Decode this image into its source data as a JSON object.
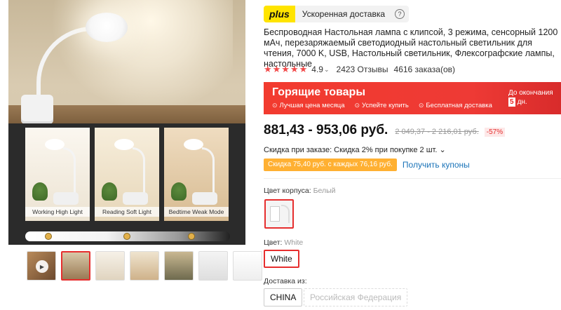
{
  "gallery": {
    "panels": [
      {
        "label": "Working High Light",
        "bg": "#f3ecdf"
      },
      {
        "label": "Reading Soft Light",
        "bg": "#f1e6d2"
      },
      {
        "label": "Bedtime Weak Mode",
        "bg": "#e6d2b4"
      }
    ],
    "thumbnails": [
      {
        "kind": "video"
      },
      {
        "kind": "image"
      },
      {
        "kind": "image"
      },
      {
        "kind": "image"
      },
      {
        "kind": "image"
      },
      {
        "kind": "image"
      },
      {
        "kind": "image"
      }
    ],
    "active_index": 1
  },
  "delivery": {
    "logo": "plus",
    "text": "Ускоренная доставка",
    "help": "?"
  },
  "product": {
    "title": "Беспроводная Настольная лампа с клипсой, 3 режима, сенсорный 1200 мАч, перезаряжаемый светодиодный настольный светильник для чтения, 7000 K, USB, Настольный светильник, Флексографские лампы, настольные",
    "stars": "★★★★★",
    "rating": "4.9",
    "reviews": "2423 Отзывы",
    "orders": "4616 заказа(ов)"
  },
  "hot_deals": {
    "title": "Горящие товары",
    "benefits": [
      "Лучшая цена месяца",
      "Успейте купить",
      "Бесплатная доставка"
    ],
    "deadline_label": "До окончания",
    "days": "5",
    "days_unit": "дн."
  },
  "price": {
    "current": "881,43 - 953,06 руб.",
    "old": "2 049,37 - 2 216,01 руб.",
    "discount": "-57%"
  },
  "order_discount": "Скидка при заказе: Скидка 2% при покупке 2 шт. ⌄",
  "coupon": {
    "chip": "Скидка 75,40 руб. с каждых 76,16 руб.",
    "link": "Получить купоны"
  },
  "options": {
    "body_color_label": "Цвет корпуса:",
    "body_color_value": "Белый",
    "color_label": "Цвет:",
    "color_value": "White",
    "color_chip": "White",
    "ship_from_label": "Доставка из:",
    "ship_from": [
      "CHINA",
      "Российская Федерация"
    ]
  },
  "colors": {
    "accent_red": "#e62e2e",
    "plus_yellow": "#ffe400",
    "coupon_orange": "#ffb032",
    "link_blue": "#1a73b8"
  }
}
